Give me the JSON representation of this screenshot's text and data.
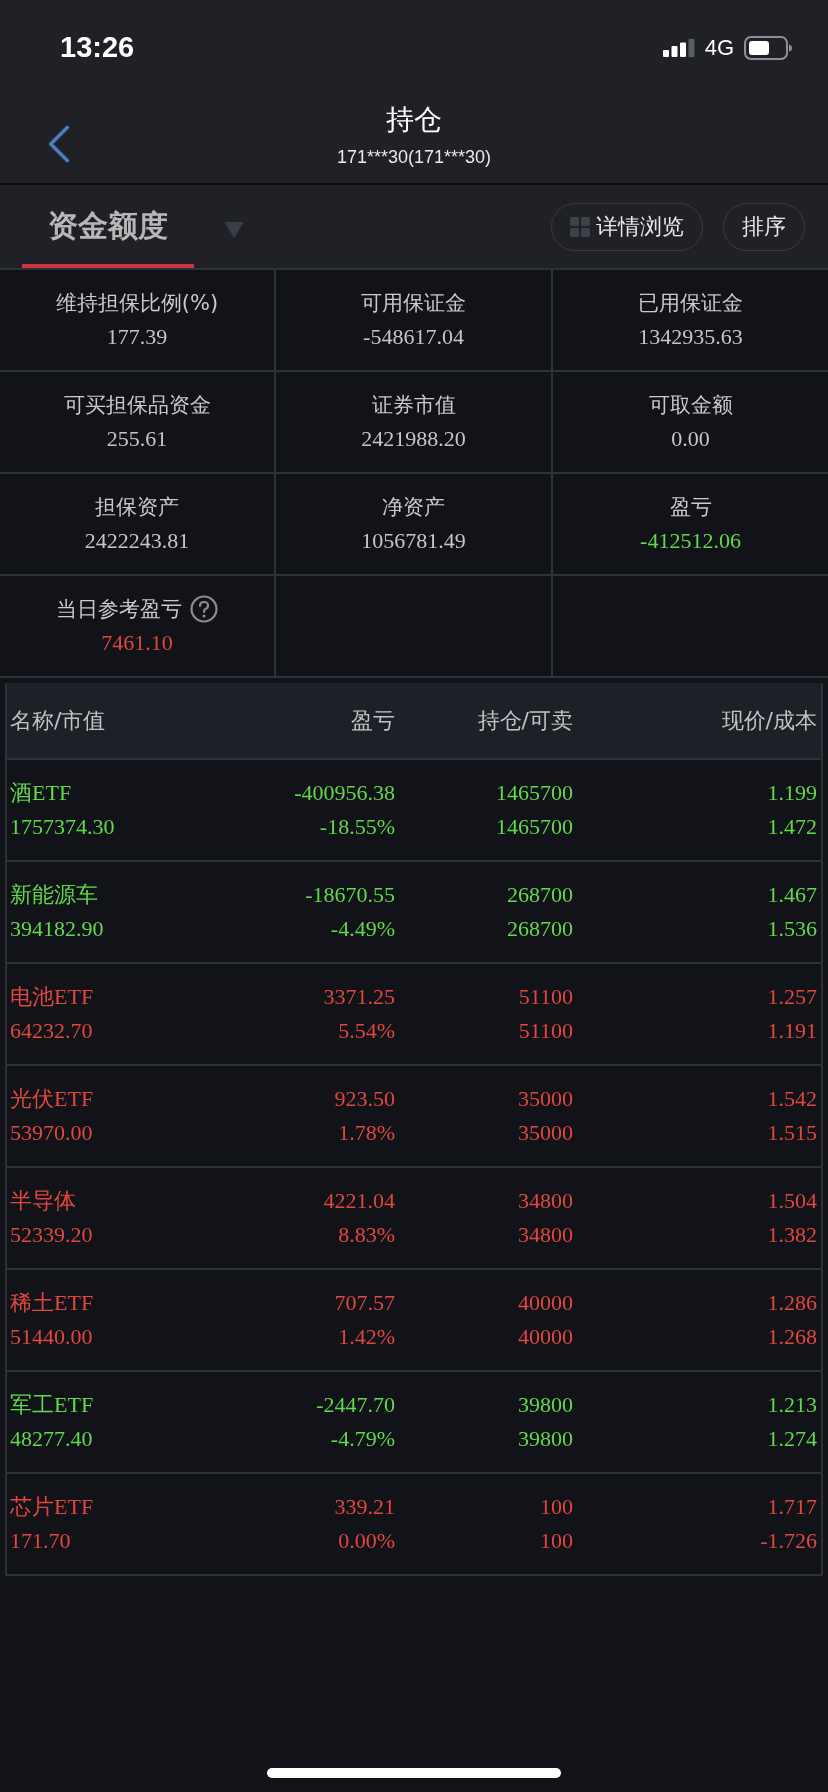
{
  "status_bar": {
    "time": "13:26",
    "network": "4G"
  },
  "nav": {
    "title": "持仓",
    "subtitle": "171***30(171***30)"
  },
  "toolbar": {
    "tabs": [
      {
        "label": "资金额度",
        "selected": true
      }
    ],
    "buttons": [
      {
        "label": "详情浏览",
        "kind": "grid"
      },
      {
        "label": "排序",
        "kind": "plain"
      }
    ]
  },
  "summary": [
    {
      "label": "维持担保比例(%)",
      "value": "177.39",
      "color": "#c6c6c6",
      "help": false
    },
    {
      "label": "可用保证金",
      "value": "-548617.04",
      "color": "#c6c6c6",
      "help": false
    },
    {
      "label": "已用保证金",
      "value": "1342935.63",
      "color": "#c6c6c6",
      "help": false
    },
    {
      "label": "可买担保品资金",
      "value": "255.61",
      "color": "#c6c6c6",
      "help": false
    },
    {
      "label": "证券市值",
      "value": "2421988.20",
      "color": "#c6c6c6",
      "help": false
    },
    {
      "label": "可取金额",
      "value": "0.00",
      "color": "#c6c6c6",
      "help": false
    },
    {
      "label": "担保资产",
      "value": "2422243.81",
      "color": "#c6c6c6",
      "help": false
    },
    {
      "label": "净资产",
      "value": "1056781.49",
      "color": "#c6c6c6",
      "help": false
    },
    {
      "label": "盈亏",
      "value": "-412512.06",
      "color": "#62d94b",
      "help": false
    },
    {
      "label": "当日参考盈亏",
      "value": "7461.10",
      "color": "#e2463f",
      "help": true
    }
  ],
  "table": {
    "columns": [
      "名称/市值",
      "盈亏",
      "持仓/可卖",
      "现价/成本"
    ],
    "rows": [
      {
        "name": "酒ETF",
        "market_value": "1757374.30",
        "pnl": "-400956.38",
        "pnl_pct": "-18.55%",
        "holding": "1465700",
        "sellable": "1465700",
        "price": "1.199",
        "cost": "1.472",
        "color": "#62d94b"
      },
      {
        "name": "新能源车",
        "market_value": "394182.90",
        "pnl": "-18670.55",
        "pnl_pct": "-4.49%",
        "holding": "268700",
        "sellable": "268700",
        "price": "1.467",
        "cost": "1.536",
        "color": "#62d94b"
      },
      {
        "name": "电池ETF",
        "market_value": "64232.70",
        "pnl": "3371.25",
        "pnl_pct": "5.54%",
        "holding": "51100",
        "sellable": "51100",
        "price": "1.257",
        "cost": "1.191",
        "color": "#e2463f"
      },
      {
        "name": "光伏ETF",
        "market_value": "53970.00",
        "pnl": "923.50",
        "pnl_pct": "1.78%",
        "holding": "35000",
        "sellable": "35000",
        "price": "1.542",
        "cost": "1.515",
        "color": "#e2463f"
      },
      {
        "name": "半导体",
        "market_value": "52339.20",
        "pnl": "4221.04",
        "pnl_pct": "8.83%",
        "holding": "34800",
        "sellable": "34800",
        "price": "1.504",
        "cost": "1.382",
        "color": "#e2463f"
      },
      {
        "name": "稀土ETF",
        "market_value": "51440.00",
        "pnl": "707.57",
        "pnl_pct": "1.42%",
        "holding": "40000",
        "sellable": "40000",
        "price": "1.286",
        "cost": "1.268",
        "color": "#e2463f"
      },
      {
        "name": "军工ETF",
        "market_value": "48277.40",
        "pnl": "-2447.70",
        "pnl_pct": "-4.79%",
        "holding": "39800",
        "sellable": "39800",
        "price": "1.213",
        "cost": "1.274",
        "color": "#62d94b"
      },
      {
        "name": "芯片ETF",
        "market_value": "171.70",
        "pnl": "339.21",
        "pnl_pct": "0.00%",
        "holding": "100",
        "sellable": "100",
        "price": "1.717",
        "cost": "-1.726",
        "color": "#e2463f"
      }
    ]
  }
}
